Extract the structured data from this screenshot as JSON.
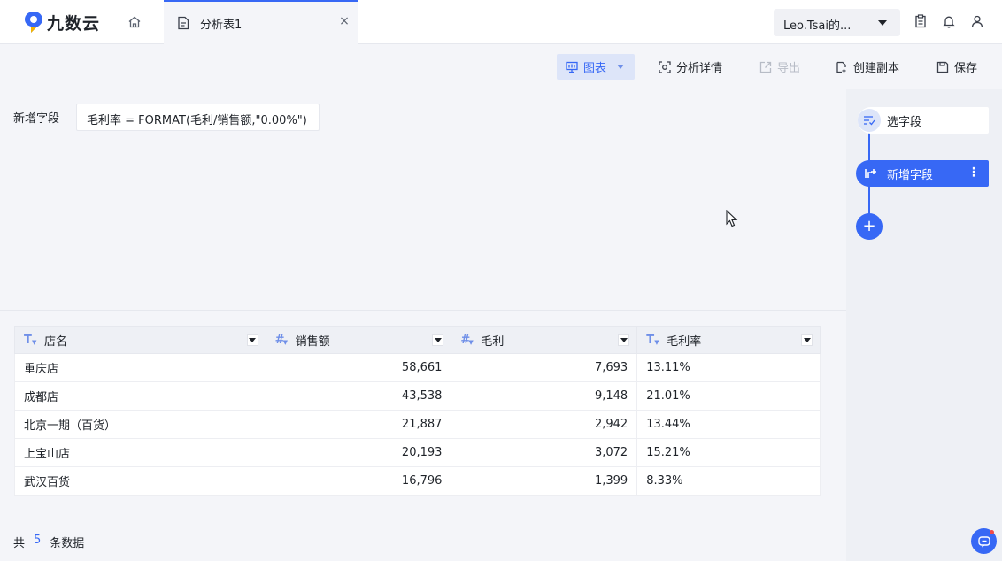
{
  "app": {
    "logo_text": "九数云",
    "tab_label": "分析表1",
    "tab_close": "×",
    "user_label": "Leo.Tsai的..."
  },
  "toolbar": {
    "chart_label": "图表",
    "analysis_detail_label": "分析详情",
    "export_label": "导出",
    "create_copy_label": "创建副本",
    "save_label": "保存"
  },
  "editor": {
    "field_label": "新增字段",
    "formula": "毛利率 = FORMAT(毛利/销售额,\"0.00%\")"
  },
  "pipeline": {
    "steps": [
      {
        "label": "选字段"
      },
      {
        "label": "新增字段"
      }
    ],
    "add_label": "+",
    "more_label": "⋮"
  },
  "table": {
    "columns": [
      {
        "name": "店名",
        "type_icon": "T"
      },
      {
        "name": "销售额",
        "type_icon": "#"
      },
      {
        "name": "毛利",
        "type_icon": "#"
      },
      {
        "name": "毛利率",
        "type_icon": "T"
      }
    ],
    "rows": [
      [
        "重庆店",
        "58,661",
        "7,693",
        "13.11%"
      ],
      [
        "成都店",
        "43,538",
        "9,148",
        "21.01%"
      ],
      [
        "北京一期（百货）",
        "21,887",
        "2,942",
        "13.44%"
      ],
      [
        "上宝山店",
        "20,193",
        "3,072",
        "15.21%"
      ],
      [
        "武汉百货",
        "16,796",
        "1,399",
        "8.33%"
      ]
    ]
  },
  "footer": {
    "prefix": "共",
    "count": "5",
    "suffix": "条数据"
  },
  "colors": {
    "accent": "#3768f5",
    "accent_light": "#dde5f9"
  }
}
